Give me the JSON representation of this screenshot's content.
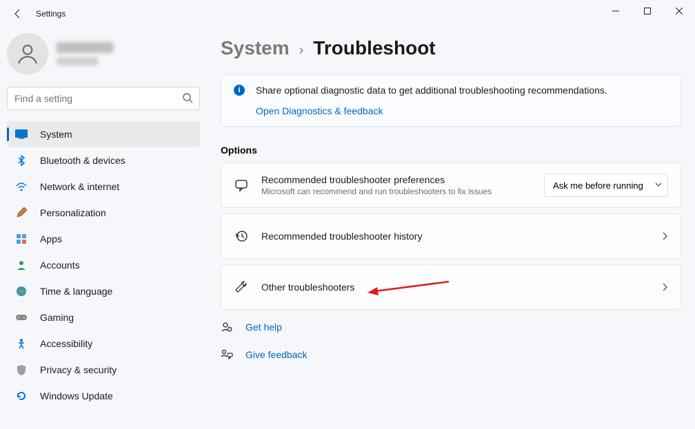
{
  "titlebar": {
    "title": "Settings"
  },
  "search": {
    "placeholder": "Find a setting"
  },
  "nav": {
    "items": [
      {
        "id": "system",
        "label": "System"
      },
      {
        "id": "bluetooth",
        "label": "Bluetooth & devices"
      },
      {
        "id": "network",
        "label": "Network & internet"
      },
      {
        "id": "personalization",
        "label": "Personalization"
      },
      {
        "id": "apps",
        "label": "Apps"
      },
      {
        "id": "accounts",
        "label": "Accounts"
      },
      {
        "id": "time",
        "label": "Time & language"
      },
      {
        "id": "gaming",
        "label": "Gaming"
      },
      {
        "id": "accessibility",
        "label": "Accessibility"
      },
      {
        "id": "privacy",
        "label": "Privacy & security"
      },
      {
        "id": "update",
        "label": "Windows Update"
      }
    ],
    "active": "system"
  },
  "breadcrumb": {
    "parent": "System",
    "current": "Troubleshoot"
  },
  "banner": {
    "text": "Share optional diagnostic data to get additional troubleshooting recommendations.",
    "link": "Open Diagnostics & feedback"
  },
  "options": {
    "heading": "Options",
    "pref": {
      "title": "Recommended troubleshooter preferences",
      "sub": "Microsoft can recommend and run troubleshooters to fix issues",
      "select": "Ask me before running"
    },
    "history": {
      "title": "Recommended troubleshooter history"
    },
    "other": {
      "title": "Other troubleshooters"
    }
  },
  "help": {
    "get": "Get help",
    "feedback": "Give feedback"
  }
}
